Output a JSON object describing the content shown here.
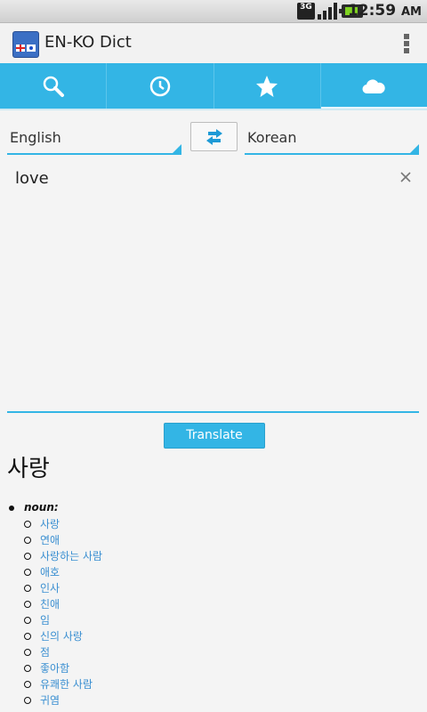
{
  "status_bar": {
    "network": "3G",
    "time": "12:59",
    "meridiem": "AM"
  },
  "action_bar": {
    "title": "EN-KO Dict"
  },
  "tabs": [
    {
      "icon": "search-icon",
      "selected": false
    },
    {
      "icon": "history-clock-icon",
      "selected": false
    },
    {
      "icon": "star-icon",
      "selected": false
    },
    {
      "icon": "cloud-icon",
      "selected": true
    }
  ],
  "languages": {
    "source": "English",
    "target": "Korean"
  },
  "input": {
    "value": "love"
  },
  "translate_label": "Translate",
  "result": {
    "word": "사랑",
    "part_of_speech": "noun:",
    "meanings": [
      "사랑",
      "연애",
      "사랑하는 사람",
      "애호",
      "인사",
      "친애",
      "임",
      "신의 사랑",
      "점",
      "좋아함",
      "유쾌한 사람",
      "귀염"
    ]
  },
  "colors": {
    "accent": "#33b5e5",
    "link": "#3a8fd1",
    "background": "#f4f4f4"
  }
}
